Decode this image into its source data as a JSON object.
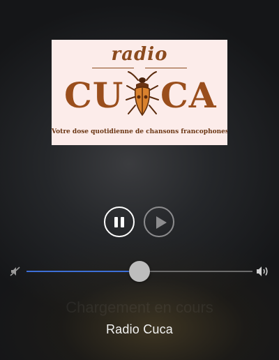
{
  "artwork": {
    "logo_word_radio": "radio",
    "logo_word_left": "CU",
    "logo_word_right": "CA",
    "tagline": "Votre dose quotidienne de chansons francophones"
  },
  "controls": {
    "pause_icon": "pause-icon",
    "play_icon": "play-icon"
  },
  "volume": {
    "level": 0.5,
    "min_icon": "volume-mute-icon",
    "max_icon": "volume-max-icon",
    "fill_color": "#3d6fd6"
  },
  "now_playing": {
    "ghost_text": "Chargement en cours",
    "station": "Radio Cuca"
  }
}
